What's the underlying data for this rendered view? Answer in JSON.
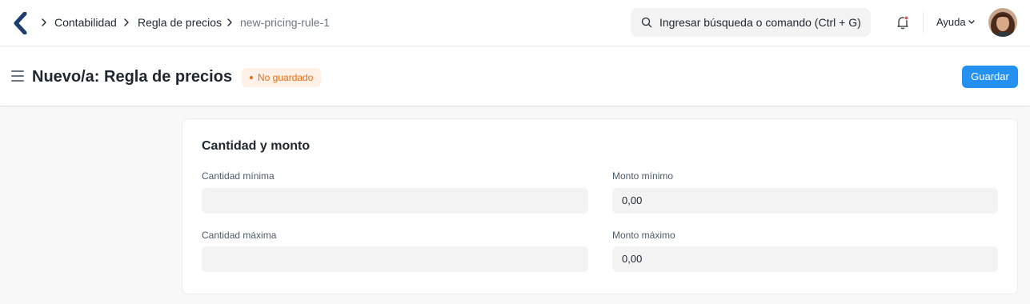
{
  "navbar": {
    "breadcrumbs": [
      "Contabilidad",
      "Regla de precios",
      "new-pricing-rule-1"
    ],
    "search_placeholder": "Ingresar búsqueda o comando (Ctrl + G)",
    "help_label": "Ayuda"
  },
  "page": {
    "title": "Nuevo/a: Regla de precios",
    "status_badge": "No guardado",
    "save_label": "Guardar"
  },
  "section": {
    "title": "Cantidad y monto",
    "fields": {
      "min_qty": {
        "label": "Cantidad mínima",
        "value": ""
      },
      "min_amt": {
        "label": "Monto mínimo",
        "value": "0,00"
      },
      "max_qty": {
        "label": "Cantidad máxima",
        "value": ""
      },
      "max_amt": {
        "label": "Monto máximo",
        "value": "0,00"
      }
    }
  },
  "colors": {
    "primary": "#2490ef",
    "badge_text": "#e86c13",
    "badge_bg": "#fff1e7",
    "logo": "#1c3d6e"
  }
}
